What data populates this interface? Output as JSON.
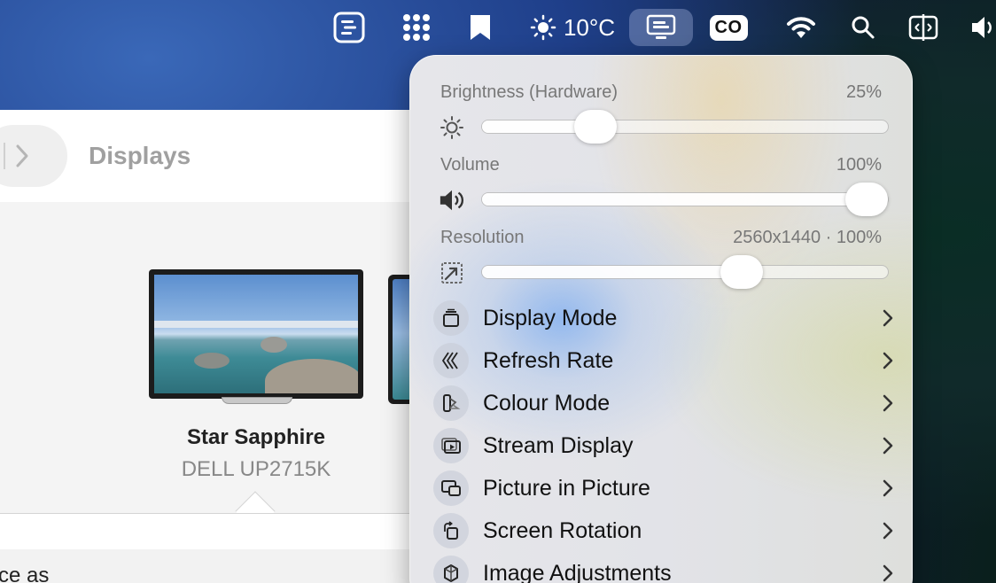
{
  "menubar": {
    "items": [
      {
        "name": "notes-icon"
      },
      {
        "name": "apps-grid-icon"
      },
      {
        "name": "bookmark-icon"
      },
      {
        "name": "weather",
        "text": "10°C"
      },
      {
        "name": "display-menu-icon",
        "active": true
      },
      {
        "name": "co-badge",
        "text": "CO"
      },
      {
        "name": "wifi-icon"
      },
      {
        "name": "search-icon"
      },
      {
        "name": "split-view-icon"
      },
      {
        "name": "volume-icon"
      }
    ],
    "weather_text": "10°C",
    "co_text": "CO"
  },
  "settings": {
    "page_title": "Displays",
    "display": {
      "name": "Star Sapphire",
      "model": "DELL UP2715K"
    },
    "bottom_text": "ce as"
  },
  "popover": {
    "sliders": [
      {
        "label": "Brightness (Hardware)",
        "value_text": "25%",
        "level": 0.28,
        "icon": "sun-icon"
      },
      {
        "label": "Volume",
        "value_text": "100%",
        "level": 1.0,
        "icon": "speaker-icon"
      },
      {
        "label": "Resolution",
        "value_text": "2560x1440 · 100%",
        "level": 0.64,
        "icon": "scale-icon"
      }
    ],
    "menu": [
      {
        "label": "Display Mode",
        "icon": "display-mode-icon"
      },
      {
        "label": "Refresh Rate",
        "icon": "refresh-rate-icon"
      },
      {
        "label": "Colour Mode",
        "icon": "colour-mode-icon"
      },
      {
        "label": "Stream Display",
        "icon": "stream-display-icon"
      },
      {
        "label": "Picture in Picture",
        "icon": "pip-icon"
      },
      {
        "label": "Screen Rotation",
        "icon": "rotation-icon"
      },
      {
        "label": "Image Adjustments",
        "icon": "image-adjust-icon"
      }
    ]
  }
}
